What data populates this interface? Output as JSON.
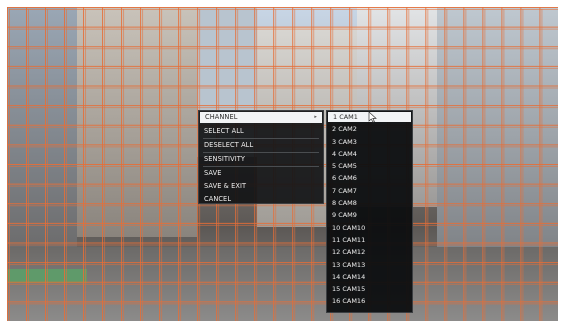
{
  "context_menu": {
    "items": [
      {
        "label": "CHANNEL",
        "has_submenu": true
      },
      {
        "label": "SELECT ALL"
      },
      {
        "label": "DESELECT ALL"
      },
      {
        "label": "SENSITIVITY"
      },
      {
        "label": "SAVE"
      },
      {
        "label": "SAVE & EXIT"
      },
      {
        "label": "CANCEL"
      }
    ],
    "submenu_arrow": "▸"
  },
  "channel_submenu": {
    "items": [
      "1 CAM1",
      "2 CAM2",
      "3 CAM3",
      "4 CAM4",
      "5 CAM5",
      "6 CAM6",
      "7 CAM7",
      "8 CAM8",
      "9 CAM9",
      "10 CAM10",
      "11 CAM11",
      "12 CAM12",
      "13 CAM13",
      "14 CAM14",
      "15 CAM15",
      "16 CAM16"
    ],
    "selected_index": 0
  },
  "colors": {
    "grid_line": "#e66e37",
    "menu_bg": "#121416",
    "highlight": "#f2f4f6"
  }
}
